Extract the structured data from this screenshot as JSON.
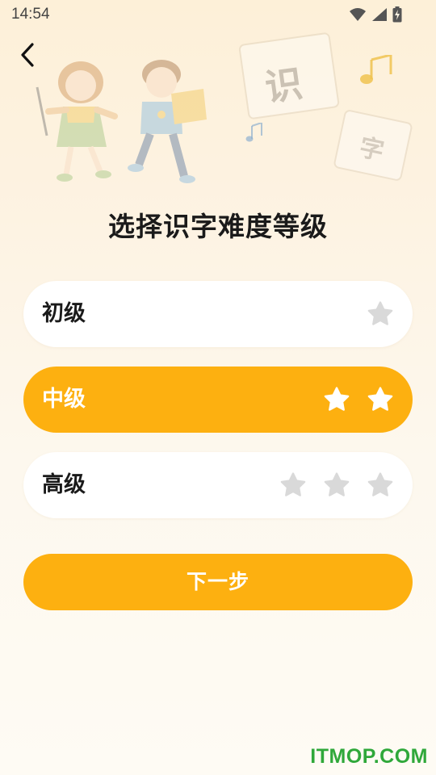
{
  "status_bar": {
    "time": "14:54",
    "icons": [
      "wifi-icon",
      "cellular-signal-icon",
      "battery-charging-icon"
    ]
  },
  "header": {
    "back_icon": "chevron-left-icon"
  },
  "banner": {
    "characters": [
      "识",
      "字"
    ],
    "decorations": [
      "music-note-icon",
      "children-reading-illustration"
    ]
  },
  "page_title": "选择识字难度等级",
  "levels": [
    {
      "label": "初级",
      "stars": 1,
      "selected": false
    },
    {
      "label": "中级",
      "stars": 2,
      "selected": true
    },
    {
      "label": "高级",
      "stars": 3,
      "selected": false
    }
  ],
  "next_button_label": "下一步",
  "watermark": "ITMOP.COM",
  "colors": {
    "accent": "#fdb010",
    "star_inactive": "#d9d9d9",
    "star_active": "#ffffff",
    "text_primary": "#1a1a1a",
    "watermark": "#2fa83a"
  }
}
